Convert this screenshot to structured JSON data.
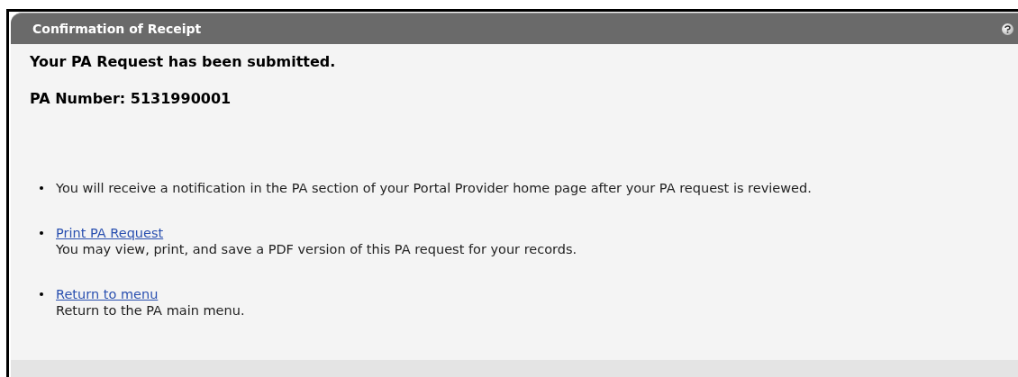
{
  "panel": {
    "title": "Confirmation of Receipt"
  },
  "heading": "Your PA Request has been submitted.",
  "pa_number": "PA Number: 5131990001",
  "items": [
    {
      "kind": "text",
      "text": "You will receive a notification in the PA section of your Portal Provider home page after your PA request is reviewed."
    },
    {
      "kind": "link",
      "link": "Print PA Request",
      "text": "You may view, print, and save a PDF version of this PA request for your records."
    },
    {
      "kind": "link",
      "link": "Return to menu",
      "text": "Return to the PA main menu."
    }
  ]
}
